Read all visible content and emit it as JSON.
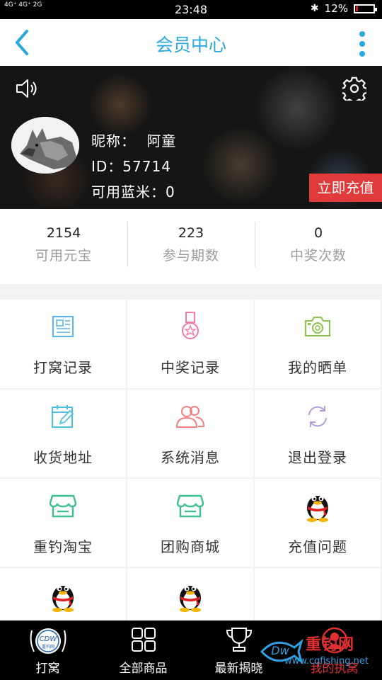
{
  "status_bar": {
    "signal": "4G⁺ 4G⁺ 2G",
    "time": "23:48",
    "battery": "12%",
    "battery_level": 0.12
  },
  "header": {
    "title": "会员中心"
  },
  "profile": {
    "nickname_label": "昵称：",
    "nickname": "阿童",
    "id_text": "ID：57714",
    "balance_text": "可用蓝米：0",
    "recharge_label": "立即充值"
  },
  "stats": [
    {
      "value": "2154",
      "label": "可用元宝"
    },
    {
      "value": "223",
      "label": "参与期数"
    },
    {
      "value": "0",
      "label": "中奖次数"
    }
  ],
  "menu": [
    {
      "label": "打窝记录",
      "icon": "document-icon",
      "color": "#5bb5e8"
    },
    {
      "label": "中奖记录",
      "icon": "medal-icon",
      "color": "#f07aa8"
    },
    {
      "label": "我的晒单",
      "icon": "camera-icon",
      "color": "#8bc34a"
    },
    {
      "label": "收货地址",
      "icon": "calendar-edit-icon",
      "color": "#4dc0e0"
    },
    {
      "label": "系统消息",
      "icon": "users-icon",
      "color": "#f28080"
    },
    {
      "label": "退出登录",
      "icon": "refresh-icon",
      "color": "#b39ddb"
    },
    {
      "label": "重钓淘宝",
      "icon": "store-icon",
      "color": "#3fbf8f"
    },
    {
      "label": "团购商城",
      "icon": "store-icon",
      "color": "#3fbf8f"
    },
    {
      "label": "充值问题",
      "icon": "qq-penguin-icon",
      "color": "#000000"
    },
    {
      "label": "",
      "icon": "qq-penguin-icon",
      "color": "#000000"
    },
    {
      "label": "",
      "icon": "qq-penguin-icon",
      "color": "#000000"
    }
  ],
  "bottom_nav": [
    {
      "label": "打窝",
      "icon": "brand-logo-icon"
    },
    {
      "label": "全部商品",
      "icon": "grid-icon"
    },
    {
      "label": "最新揭晓",
      "icon": "trophy-icon"
    },
    {
      "label": "我的执窝",
      "icon": "user-icon"
    }
  ],
  "watermark": {
    "text": "重钓网",
    "url": "www.cqfishing.net"
  }
}
